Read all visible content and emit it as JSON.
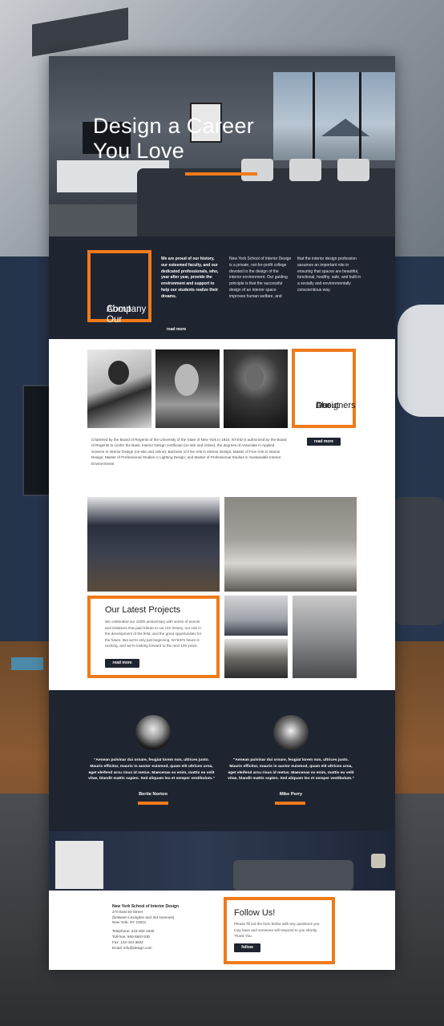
{
  "hero": {
    "title_line1": "Design a Career",
    "title_line2": "You Love"
  },
  "about": {
    "heading_line1": "About Our",
    "heading_line2": "Company",
    "col1": "We are proud of our history, our esteemed faculty, and our dedicated professionals, who, year after year, provide the environment and support to help our students realize their dreams.",
    "col2": "New York School of Interior Design is a private, not-for-profit college devoted to the design of the interior environment. Our guiding principle is that the successful design of an interior space improves human welfare, and",
    "col3": "that the interior design profession assumes an important role in ensuring that spaces are beautiful, functional, healthy, safe, and built in a socially and environmentally conscientious way.",
    "read_more": "read more"
  },
  "designers": {
    "heading_line1": "About",
    "heading_line2": "Our",
    "heading_line3": "Designers",
    "paragraph": "Chartered by the Board of Regents of the University of the State of New York in 1924, NYSID is authorized by the Board of Regents to confer the Basic Interior Design certificate (on-site and online); the degrees of Associate in Applied Science in Interior Design (on-site and online); Bachelor of Fine Arts in Interior Design; Master of Fine Arts in Interior Design; Master of Professional Studies in Lighting Design; and Master of Professional Studies in Sustainable Interior Environments.",
    "read_more": "read more"
  },
  "projects": {
    "heading": "Our Latest Projects",
    "description": "We celebrated our 100th anniversary with series of events and initiatives that paid tribute to our rich history, our role in the development of the field, and the great opportunities for the future. But we're only just beginning. NYSID's future is exciting, and we're looking forward to the next 100 years.",
    "read_more": "read more"
  },
  "testimonials": [
    {
      "quote": "\"Aenean pulvinar dui ornare, feugiat lorem non, ultrices justo. Mauris efficitur, mauris in auctor euismod, quam elit ultrices urna, eget eleifend arcu risus id metus. Maecenas ex enim, mattis eu velit vitae, blandit mattis sapien. Sed aliquam leo et semper vestibulum.\"",
      "name": "Bertie Norton"
    },
    {
      "quote": "\"Aenean pulvinar dui ornare, feugiat lorem non, ultrices justo. Mauris efficitur, mauris in auctor euismod, quam elit ultrices urna, eget eleifend arcu risus id metus. Maecenas ex enim, mattis eu velit vitae, blandit mattis sapien. Sed aliquam leo et semper vestibulum.\"",
      "name": "Mike Perry"
    }
  ],
  "footer": {
    "school_name": "New York School of Interior Design",
    "address1": "270 East 50 Street",
    "address2": "(between Lexington and 3rd Avenues)",
    "address3": "New York, NY 10021",
    "telephone": "Telephone: 215-302-1530",
    "tollfree": "Toll-free: 560-55NYSID",
    "fax": "Fax: 142-444-3822",
    "email": "Email: info@design.com",
    "follow_heading": "Follow Us!",
    "follow_text": "Please fill out the form below with any questions you may have and someone will respond to you shortly. Thank You.",
    "follow_button": "follow"
  },
  "colors": {
    "accent": "#f07a1a",
    "dark": "#1f2431",
    "white": "#ffffff"
  }
}
